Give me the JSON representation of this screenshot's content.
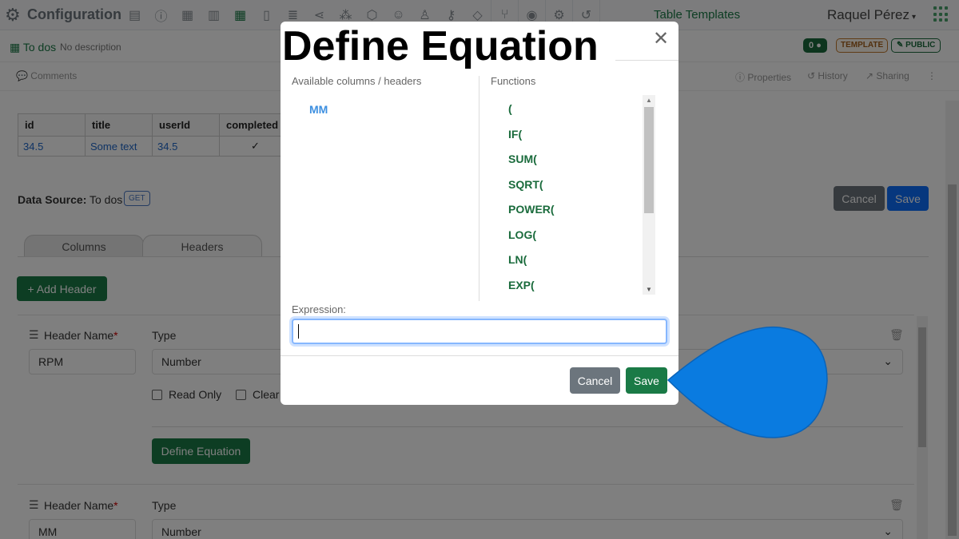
{
  "app": {
    "title": "Configuration"
  },
  "nav": {
    "icons": [
      "form-icon",
      "info-icon",
      "table-icon",
      "document-icon",
      "table-active-icon",
      "file-icon",
      "database-icon",
      "share-icon",
      "graph-icon",
      "package-icon",
      "user-icon",
      "user-outline-icon",
      "key-icon",
      "cube-icon",
      "branch-icon",
      "location-icon",
      "gears-icon",
      "history-icon"
    ],
    "table_templates": "Table Templates",
    "user": "Raquel Pérez"
  },
  "header": {
    "title": "To dos",
    "description": "No description",
    "comment_count": "0",
    "template_badge": "TEMPLATE",
    "public_badge": "PUBLIC"
  },
  "toolbar": {
    "comments": "Comments",
    "properties": "Properties",
    "history": "History",
    "sharing": "Sharing"
  },
  "preview_table": {
    "columns": [
      "id",
      "title",
      "userId",
      "completed"
    ],
    "rows": [
      [
        "34.5",
        "Some text",
        "34.5",
        "✓"
      ]
    ]
  },
  "datasource": {
    "label": "Data Source:",
    "name": "To dos",
    "method": "GET"
  },
  "actions": {
    "cancel": "Cancel",
    "save": "Save"
  },
  "tabs": [
    "Columns",
    "Headers"
  ],
  "add_header": "+ Add Header",
  "headers": [
    {
      "name_label": "Header Name",
      "type_label": "Type",
      "name": "RPM",
      "type": "Number",
      "read_only": "Read Only",
      "clear": "Clear",
      "define": "Define Equation"
    },
    {
      "name_label": "Header Name",
      "type_label": "Type",
      "name": "MM",
      "type": "Number"
    }
  ],
  "modal": {
    "title": "Define Equation",
    "columns_label": "Available columns / headers",
    "functions_label": "Functions",
    "columns": [
      "MM"
    ],
    "functions": [
      "(",
      "IF(",
      "SUM(",
      "SQRT(",
      "POWER(",
      "LOG(",
      "LN(",
      "EXP("
    ],
    "expression_label": "Expression:",
    "expression_value": "",
    "cancel": "Cancel",
    "save": "Save"
  },
  "colors": {
    "brand_green": "#1a7a46",
    "primary_blue": "#0d6efd",
    "pointer_blue": "#0a7be0"
  }
}
